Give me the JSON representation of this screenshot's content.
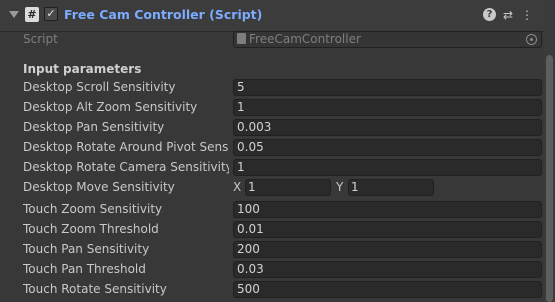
{
  "component": {
    "title": "Free Cam Controller (Script)",
    "enabled": true,
    "script_badge": "#",
    "checkmark": "✓",
    "icons": {
      "help": "?",
      "presets": "⇄",
      "more": "⋮"
    }
  },
  "script_row": {
    "label": "Script",
    "value": "FreeCamController"
  },
  "section_header": "Input parameters",
  "fields": [
    {
      "label": "Desktop Scroll Sensitivity",
      "value": "5"
    },
    {
      "label": "Desktop Alt Zoom Sensitivity",
      "value": "1"
    },
    {
      "label": "Desktop Pan Sensitivity",
      "value": "0.003"
    },
    {
      "label": "Desktop Rotate Around Pivot Sensitivity",
      "value": "0.05"
    },
    {
      "label": "Desktop Rotate Camera Sensitivity",
      "value": "1"
    },
    {
      "label": "Desktop Move Sensitivity",
      "vector": {
        "x_label": "X",
        "x": "1",
        "y_label": "Y",
        "y": "1"
      }
    },
    {
      "label": "Touch Zoom Sensitivity",
      "value": "100"
    },
    {
      "label": "Touch Zoom Threshold",
      "value": "0.01"
    },
    {
      "label": "Touch Pan Sensitivity",
      "value": "200"
    },
    {
      "label": "Touch Pan Threshold",
      "value": "0.03"
    },
    {
      "label": "Touch Rotate Sensitivity",
      "value": "500"
    }
  ],
  "colors": {
    "title": "#7cabff",
    "background": "#383838",
    "field": "#2a2a2a"
  }
}
